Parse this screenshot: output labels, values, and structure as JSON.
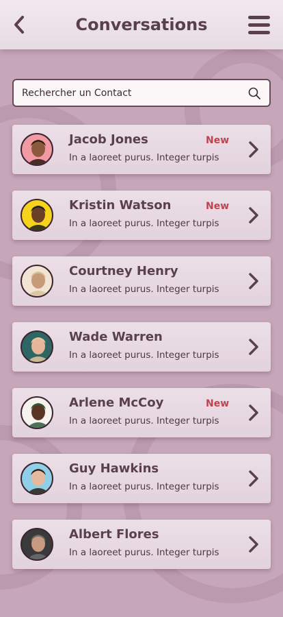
{
  "header": {
    "title": "Conversations",
    "back_icon": "chevron-left-icon",
    "menu_icon": "hamburger-menu-icon"
  },
  "search": {
    "placeholder": "Rechercher un Contact",
    "icon": "search-icon"
  },
  "contacts": [
    {
      "name": "Jacob Jones",
      "message": "In a laoreet purus. Integer turpis",
      "badge": "New",
      "avatar_bg": "#f29aa4",
      "avatar_skin": "#8b5a3c",
      "avatar_hair": "#2a1a10"
    },
    {
      "name": "Kristin Watson",
      "message": "In a laoreet purus. Integer turpis",
      "badge": "New",
      "avatar_bg": "#f5d21b",
      "avatar_skin": "#6b3e26",
      "avatar_hair": "#1b1b1b"
    },
    {
      "name": "Courtney Henry",
      "message": "In a laoreet purus. Integer turpis",
      "badge": "",
      "avatar_bg": "#f1e4d2",
      "avatar_skin": "#c79a78",
      "avatar_hair": "#d9c2a0"
    },
    {
      "name": "Wade Warren",
      "message": "In a laoreet purus. Integer turpis",
      "badge": "",
      "avatar_bg": "#2f6663",
      "avatar_skin": "#e8b49a",
      "avatar_hair": "#e3c89c"
    },
    {
      "name": "Arlene McCoy",
      "message": "In a laoreet purus. Integer turpis",
      "badge": "New",
      "avatar_bg": "#f6f3ee",
      "avatar_skin": "#5a3524",
      "avatar_hair": "#2f5b3c"
    },
    {
      "name": "Guy Hawkins",
      "message": "In a laoreet purus. Integer turpis",
      "badge": "",
      "avatar_bg": "#8fd0e8",
      "avatar_skin": "#e5b99c",
      "avatar_hair": "#2b1d14"
    },
    {
      "name": "Albert Flores",
      "message": "In a laoreet purus. Integer turpis",
      "badge": "",
      "avatar_bg": "#3a3a3a",
      "avatar_skin": "#c99a82",
      "avatar_hair": "#6d6d6d"
    }
  ],
  "colors": {
    "background": "#c5a7b9",
    "card": "#e6d8e1",
    "text": "#5a3f4c",
    "badge": "#c0414f"
  }
}
